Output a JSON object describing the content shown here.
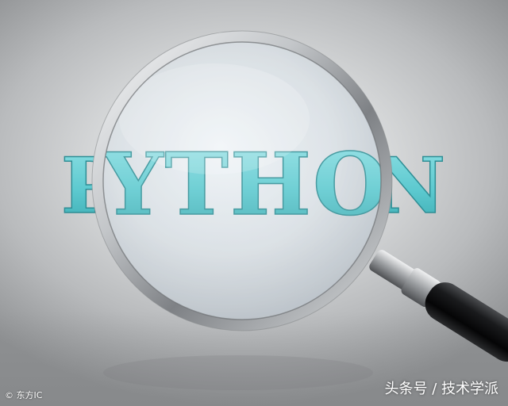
{
  "scene": {
    "word": "PYTHON",
    "word_color": "#5cc9cf",
    "word_color_magnified": "#62cdd3",
    "object": "magnifying-glass"
  },
  "watermarks": {
    "left": "© 东方IC",
    "right": "头条号 / 技术学派"
  }
}
